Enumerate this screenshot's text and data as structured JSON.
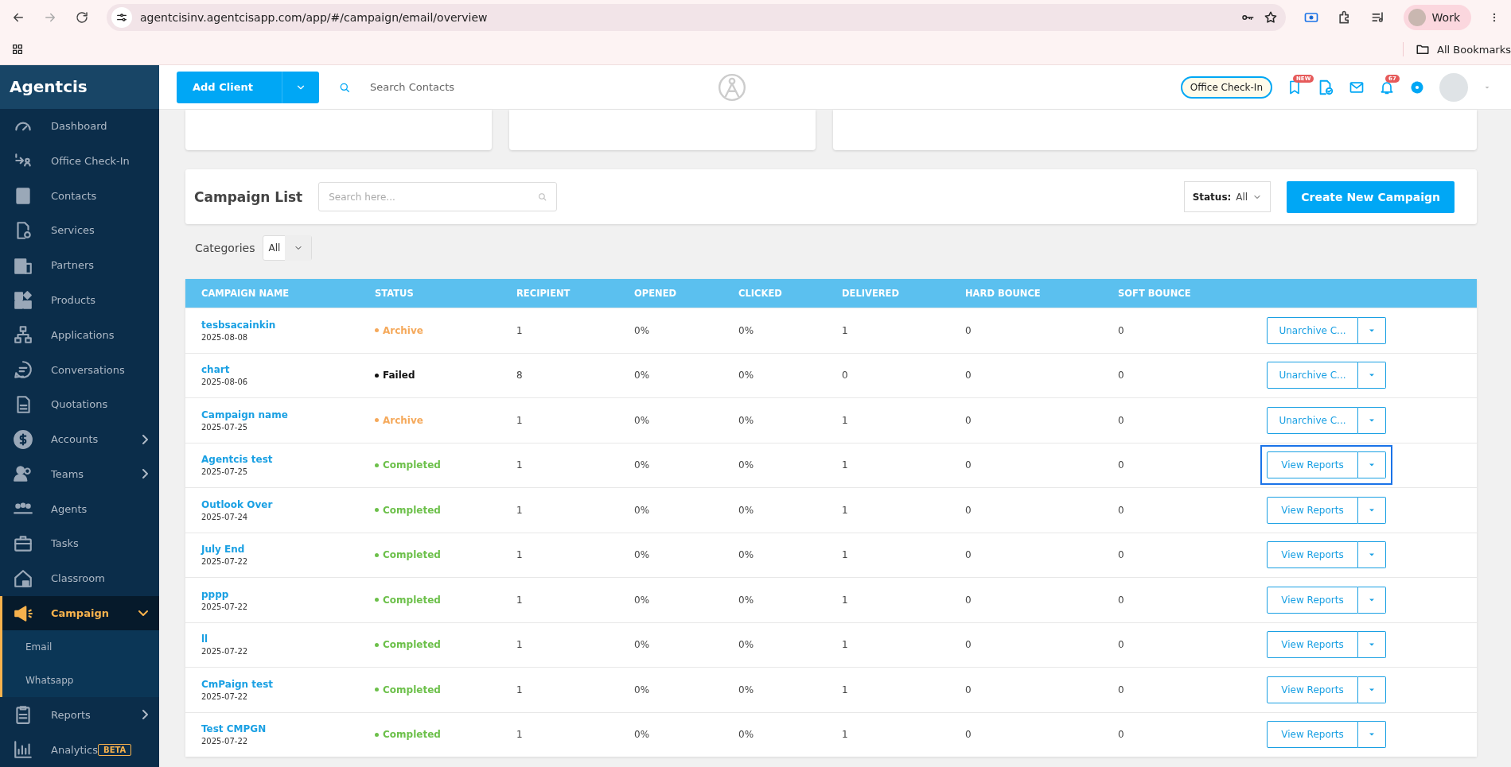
{
  "browser": {
    "url": "agentcisinv.agentcisapp.com/app/#/campaign/email/overview",
    "profile": "Work",
    "bookmarks": "All Bookmarks"
  },
  "sidebar": {
    "brand": "Agentcis",
    "items": [
      {
        "label": "Dashboard",
        "selected": false
      },
      {
        "label": "Office Check-In",
        "selected": false
      },
      {
        "label": "Contacts",
        "selected": false
      },
      {
        "label": "Services",
        "selected": false
      },
      {
        "label": "Partners",
        "selected": false
      },
      {
        "label": "Products",
        "selected": false
      },
      {
        "label": "Applications",
        "selected": false
      },
      {
        "label": "Conversations",
        "selected": false
      },
      {
        "label": "Quotations",
        "selected": false
      },
      {
        "label": "Accounts",
        "selected": false,
        "expanded": false
      },
      {
        "label": "Teams",
        "selected": false,
        "expanded": false
      },
      {
        "label": "Agents",
        "selected": false
      },
      {
        "label": "Tasks",
        "selected": false
      },
      {
        "label": "Classroom",
        "selected": false
      },
      {
        "label": "Campaign",
        "selected": true,
        "expanded": true,
        "children": [
          {
            "label": "Email",
            "selected": false
          },
          {
            "label": "Whatsapp",
            "selected": false
          }
        ]
      },
      {
        "label": "Reports",
        "selected": false,
        "expanded": false
      },
      {
        "label": "Analytics",
        "selected": false,
        "badge": "BETA"
      }
    ]
  },
  "header": {
    "add_client": "Add Client",
    "search": {
      "placeholder": "Search Contacts"
    },
    "office_check_in": "Office Check-In",
    "chat_badge": "NEW",
    "notification_badge": "67"
  },
  "campaign_list": {
    "title": "Campaign List",
    "search": {
      "placeholder": "Search here..."
    },
    "status_filter": {
      "label": "Status:",
      "value": "All"
    },
    "create_button": "Create New Campaign",
    "categories": {
      "label": "Categories",
      "value": "All"
    }
  },
  "table": {
    "columns": [
      "CAMPAIGN NAME",
      "STATUS",
      "RECIPIENT",
      "OPENED",
      "CLICKED",
      "DELIVERED",
      "HARD BOUNCE",
      "SOFT BOUNCE"
    ],
    "rows": [
      {
        "name": "tesbsacainkin",
        "date": "2025-08-08",
        "status": "Archive",
        "color": "#f5a95b",
        "recipient": "1",
        "opened": "0%",
        "clicked": "0%",
        "delivered": "1",
        "hard_bounce": "0",
        "soft_bounce": "0",
        "action": "Unarchive C...",
        "focused": false
      },
      {
        "name": "chart",
        "date": "2025-08-06",
        "status": "Failed",
        "color": "#111111",
        "recipient": "8",
        "opened": "0%",
        "clicked": "0%",
        "delivered": "0",
        "hard_bounce": "0",
        "soft_bounce": "0",
        "action": "Unarchive C...",
        "focused": false
      },
      {
        "name": "Campaign name",
        "date": "2025-07-25",
        "status": "Archive",
        "color": "#f5a95b",
        "recipient": "1",
        "opened": "0%",
        "clicked": "0%",
        "delivered": "1",
        "hard_bounce": "0",
        "soft_bounce": "0",
        "action": "Unarchive C...",
        "focused": false
      },
      {
        "name": "Agentcis test",
        "date": "2025-07-25",
        "status": "Completed",
        "color": "#6cc04a",
        "recipient": "1",
        "opened": "0%",
        "clicked": "0%",
        "delivered": "1",
        "hard_bounce": "0",
        "soft_bounce": "0",
        "action": "View Reports",
        "focused": true
      },
      {
        "name": "Outlook Over",
        "date": "2025-07-24",
        "status": "Completed",
        "color": "#6cc04a",
        "recipient": "1",
        "opened": "0%",
        "clicked": "0%",
        "delivered": "1",
        "hard_bounce": "0",
        "soft_bounce": "0",
        "action": "View Reports",
        "focused": false
      },
      {
        "name": "July End",
        "date": "2025-07-22",
        "status": "Completed",
        "color": "#6cc04a",
        "recipient": "1",
        "opened": "0%",
        "clicked": "0%",
        "delivered": "1",
        "hard_bounce": "0",
        "soft_bounce": "0",
        "action": "View Reports",
        "focused": false
      },
      {
        "name": "pppp",
        "date": "2025-07-22",
        "status": "Completed",
        "color": "#6cc04a",
        "recipient": "1",
        "opened": "0%",
        "clicked": "0%",
        "delivered": "1",
        "hard_bounce": "0",
        "soft_bounce": "0",
        "action": "View Reports",
        "focused": false
      },
      {
        "name": "ll",
        "date": "2025-07-22",
        "status": "Completed",
        "color": "#6cc04a",
        "recipient": "1",
        "opened": "0%",
        "clicked": "0%",
        "delivered": "1",
        "hard_bounce": "0",
        "soft_bounce": "0",
        "action": "View Reports",
        "focused": false
      },
      {
        "name": "CmPaign test",
        "date": "2025-07-22",
        "status": "Completed",
        "color": "#6cc04a",
        "recipient": "1",
        "opened": "0%",
        "clicked": "0%",
        "delivered": "1",
        "hard_bounce": "0",
        "soft_bounce": "0",
        "action": "View Reports",
        "focused": false
      },
      {
        "name": "Test CMPGN",
        "date": "2025-07-22",
        "status": "Completed",
        "color": "#6cc04a",
        "recipient": "1",
        "opened": "0%",
        "clicked": "0%",
        "delivered": "1",
        "hard_bounce": "0",
        "soft_bounce": "0",
        "action": "View Reports",
        "focused": false
      }
    ]
  }
}
